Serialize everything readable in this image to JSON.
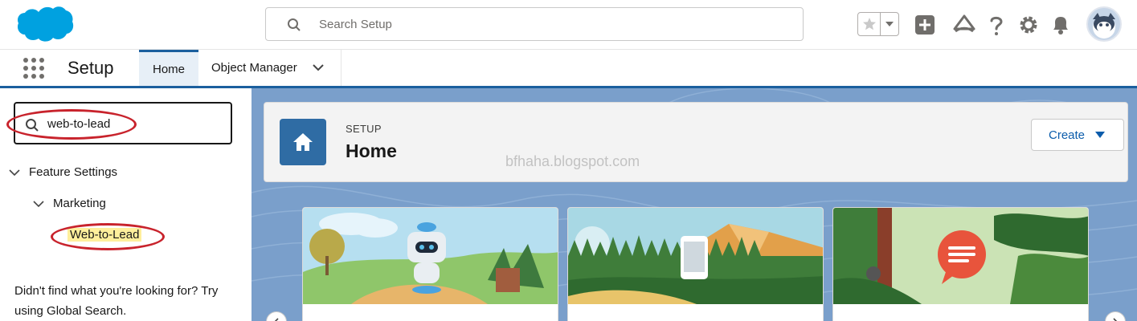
{
  "header": {
    "search_placeholder": "Search Setup",
    "brand_color": "#00a1e0"
  },
  "nav": {
    "app_name": "Setup",
    "tabs": [
      {
        "label": "Home",
        "active": true
      },
      {
        "label": "Object Manager",
        "active": false
      }
    ]
  },
  "sidebar": {
    "quick_find_value": "web-to-lead",
    "tree": {
      "level1": "Feature Settings",
      "level2": "Marketing",
      "leaf": "Web-to-Lead"
    },
    "not_found_text": "Didn't find what you're looking for? Try using Global Search."
  },
  "page_header": {
    "eyebrow": "SETUP",
    "title": "Home",
    "create_label": "Create",
    "watermark": "bfhaha.blogspot.com"
  },
  "tiles": [
    {
      "name": "einstein-tile"
    },
    {
      "name": "mobile-tile"
    },
    {
      "name": "chat-tile"
    }
  ],
  "colors": {
    "accent": "#1b5f9e",
    "annotation_ring": "#c8232c",
    "highlight": "#ffef9c"
  }
}
